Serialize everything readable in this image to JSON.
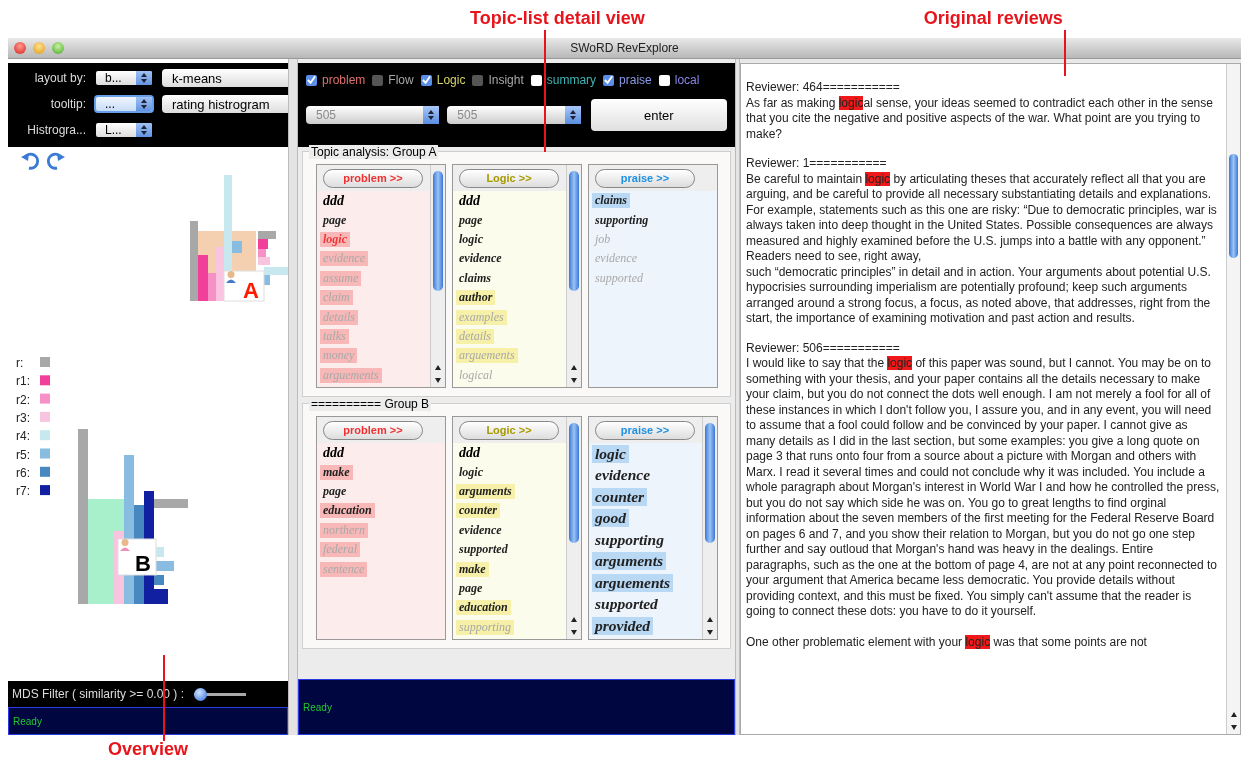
{
  "annotations": {
    "topic_list": "Topic-list detail view",
    "reviews": "Original reviews",
    "overview": "Overview"
  },
  "window": {
    "title": "SWoRD RevExplore"
  },
  "overview": {
    "controls": [
      {
        "label": "layout by:",
        "value": "b...",
        "focused": false,
        "button": "k-means"
      },
      {
        "label": "tooltip:",
        "value": "...",
        "focused": true,
        "button": "rating histrogram"
      },
      {
        "label": "Histrogra...",
        "value": "L...",
        "focused": false
      }
    ],
    "glyphs": [
      {
        "label": "A",
        "color": "#ff1a00"
      },
      {
        "label": "B",
        "color": "#000000"
      }
    ],
    "legend": [
      {
        "label": "r:",
        "color": "#a8a8a8"
      },
      {
        "label": "r1:",
        "color": "#f0409a"
      },
      {
        "label": "r2:",
        "color": "#f890c8"
      },
      {
        "label": "r3:",
        "color": "#f8c4e0"
      },
      {
        "label": "r4:",
        "color": "#c8e8f0"
      },
      {
        "label": "r5:",
        "color": "#88bce0"
      },
      {
        "label": "r6:",
        "color": "#4888c0"
      },
      {
        "label": "r7:",
        "color": "#1020a0"
      }
    ],
    "filter": {
      "label": "MDS Filter ( similarity >= 0.00 ) :",
      "level": 0
    },
    "status": "Ready"
  },
  "detail": {
    "filters": [
      {
        "label": "problem",
        "checked": true,
        "disabled": false,
        "color": "#e07070"
      },
      {
        "label": "Flow",
        "checked": false,
        "disabled": true,
        "color": "#a8a8a8"
      },
      {
        "label": "Logic",
        "checked": true,
        "disabled": false,
        "color": "#d8d468"
      },
      {
        "label": "Insight",
        "checked": false,
        "disabled": true,
        "color": "#a8a8a8"
      },
      {
        "label": "summary",
        "checked": false,
        "disabled": false,
        "color": "#40b4b4"
      },
      {
        "label": "praise",
        "checked": true,
        "disabled": false,
        "color": "#8a9ae8"
      },
      {
        "label": "local",
        "checked": false,
        "disabled": false,
        "color": "#8a84e8"
      }
    ],
    "selects": [
      "505",
      "505"
    ],
    "enter": "enter",
    "groups": [
      {
        "title": "Topic analysis: Group A",
        "columns": [
          {
            "header": "problem >>",
            "kind": "problem",
            "scrollable": true,
            "large": false,
            "words": [
              {
                "text": "ddd",
                "kind": "title"
              },
              {
                "text": "page",
                "kind": "plain"
              },
              {
                "text": "logic",
                "kind": "key"
              },
              {
                "text": "evidence",
                "kind": "mark-faded"
              },
              {
                "text": "assume",
                "kind": "mark-faded"
              },
              {
                "text": "claim",
                "kind": "mark-faded"
              },
              {
                "text": "details",
                "kind": "mark-faded"
              },
              {
                "text": "talks",
                "kind": "mark-faded"
              },
              {
                "text": "money",
                "kind": "mark-faded"
              },
              {
                "text": "arguements",
                "kind": "mark-faded"
              }
            ]
          },
          {
            "header": "Logic >>",
            "kind": "logic",
            "scrollable": true,
            "large": false,
            "words": [
              {
                "text": "ddd",
                "kind": "title"
              },
              {
                "text": "page",
                "kind": "plain"
              },
              {
                "text": "logic",
                "kind": "plain"
              },
              {
                "text": "evidence",
                "kind": "plain"
              },
              {
                "text": "claims",
                "kind": "plain"
              },
              {
                "text": "author",
                "kind": "mark"
              },
              {
                "text": "examples",
                "kind": "mark-faded"
              },
              {
                "text": "details",
                "kind": "mark-faded"
              },
              {
                "text": "arguements",
                "kind": "mark-faded"
              },
              {
                "text": "logical",
                "kind": "faded"
              }
            ]
          },
          {
            "header": "praise >>",
            "kind": "praise",
            "scrollable": false,
            "large": false,
            "words": [
              {
                "text": "claims",
                "kind": "mark"
              },
              {
                "text": "supporting",
                "kind": "plain"
              },
              {
                "text": "job",
                "kind": "faded"
              },
              {
                "text": "evidence",
                "kind": "faded"
              },
              {
                "text": "supported",
                "kind": "faded"
              }
            ]
          }
        ]
      },
      {
        "title": "========== Group B",
        "columns": [
          {
            "header": "problem >>",
            "kind": "problem",
            "scrollable": false,
            "large": false,
            "words": [
              {
                "text": "ddd",
                "kind": "title"
              },
              {
                "text": "make",
                "kind": "mark"
              },
              {
                "text": "page",
                "kind": "plain"
              },
              {
                "text": "education",
                "kind": "mark"
              },
              {
                "text": "northern",
                "kind": "mark-faded"
              },
              {
                "text": "federal",
                "kind": "mark-faded"
              },
              {
                "text": "sentence",
                "kind": "mark-faded"
              }
            ]
          },
          {
            "header": "Logic >>",
            "kind": "logic",
            "scrollable": true,
            "large": false,
            "words": [
              {
                "text": "ddd",
                "kind": "title"
              },
              {
                "text": "logic",
                "kind": "plain"
              },
              {
                "text": "arguments",
                "kind": "mark"
              },
              {
                "text": "counter",
                "kind": "mark"
              },
              {
                "text": "evidence",
                "kind": "plain"
              },
              {
                "text": "supported",
                "kind": "plain"
              },
              {
                "text": "make",
                "kind": "mark"
              },
              {
                "text": "page",
                "kind": "plain"
              },
              {
                "text": "education",
                "kind": "mark"
              },
              {
                "text": "supporting",
                "kind": "mark-faded"
              }
            ]
          },
          {
            "header": "praise >>",
            "kind": "praise",
            "scrollable": true,
            "large": true,
            "words": [
              {
                "text": "logic",
                "kind": "mark"
              },
              {
                "text": "evidence",
                "kind": "plain"
              },
              {
                "text": "counter",
                "kind": "mark"
              },
              {
                "text": "good",
                "kind": "mark"
              },
              {
                "text": "supporting",
                "kind": "plain"
              },
              {
                "text": "arguments",
                "kind": "mark"
              },
              {
                "text": "arguements",
                "kind": "mark"
              },
              {
                "text": "supported",
                "kind": "plain"
              },
              {
                "text": "provided",
                "kind": "mark"
              }
            ]
          }
        ]
      }
    ],
    "status": "Ready"
  },
  "reviews": [
    {
      "header": "Reviewer: 464===========",
      "parts": [
        {
          "text": "As far as making ",
          "highlight": false
        },
        {
          "text": "logic",
          "highlight": true
        },
        {
          "text": "al sense, your ideas seemed to contradict each other in the sense that you cite the negative and positive aspects of the war. What point are you trying to make?",
          "highlight": false
        }
      ]
    },
    {
      "header": "Reviewer: 1===========",
      "parts": [
        {
          "text": "Be careful to maintain ",
          "highlight": false
        },
        {
          "text": "logic",
          "highlight": true
        },
        {
          "text": " by articulating theses that accurately reflect all that you are arguing, and be careful to provide all necessary substantiating details and explanations.  For example,  statements such as this one are risky:  “Due to democratic principles, war is always taken into deep thought in the United States.  Possible consequences are always measured and highly examined before the U.S. jumps into a battle with any opponent.”  Readers need to see, right away,\nsuch “democratic principles” in detail and in action.   Your arguments about potential U.S. hypocrisies surrounding imperialism are potentially profound; keep such arguments arranged around a strong focus, a focus, as noted above, that addresses, right from the start, the importance of examining motivation and past action and results.",
          "highlight": false
        }
      ]
    },
    {
      "header": "Reviewer: 506===========",
      "parts": [
        {
          "text": "I would like to say that the ",
          "highlight": false
        },
        {
          "text": "logic",
          "highlight": true
        },
        {
          "text": " of this paper was sound, but I cannot. You may be on to something with your thesis, and your paper contains all the details necessary to make your claim, but you do not connect the dots well enough. I am not merely a fool for all of these instances in which I don't follow you, I assure you, and in any event, you will need to assume that a fool could follow and be convinced by your paper. I cannot give as many details as I did in the last section, but some examples: you give a long quote on page 3 that runs onto four from a source about a picture with Morgan and others with Marx. I read it several times and could not conclude why it was included. You include a whole paragraph about Morgan's interest in World War I and how he controlled the press, but you do not say which side he was on. You go to great lengths to find orginal information about the seven members of the first meeting for the Federal Reserve Board on pages 6 and 7, and you show their relation to Morgan, but you do not go one step further and say outloud that Morgan's hand was heavy in the dealings. Entire paragraphs, such as the one at the bottom of page 4, are not at any point reconnected to your argument that America became less democratic. You provide details without providing context, and this must be fixed. You simply can't assume that the reader is going to connect these dots: you have to do it yourself.\n\nOne other problematic element with your ",
          "highlight": false
        },
        {
          "text": "logic",
          "highlight": true
        },
        {
          "text": " was that some points are not",
          "highlight": false
        }
      ]
    }
  ]
}
